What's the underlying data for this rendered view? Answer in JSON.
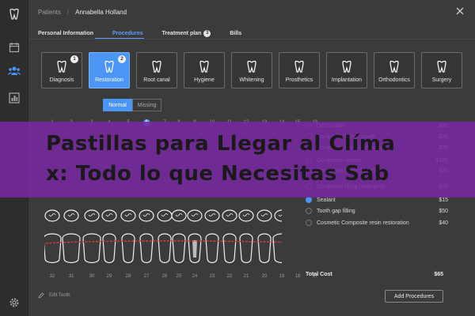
{
  "breadcrumb": {
    "section": "Patients",
    "separator": "/",
    "patient": "Annabella Holland"
  },
  "tabs": [
    {
      "label": "Personal Information",
      "active": false
    },
    {
      "label": "Procedures",
      "active": true
    },
    {
      "label": "Treatment plan",
      "badge": "3",
      "active": false
    },
    {
      "label": "Bills",
      "active": false
    }
  ],
  "procedures": [
    {
      "label": "Diagnosis",
      "icon": "tooth-search-icon",
      "badge": "1",
      "active": false
    },
    {
      "label": "Restoration",
      "icon": "tooth-restoration-icon",
      "badge": "2",
      "active": true
    },
    {
      "label": "Root canal",
      "icon": "tooth-root-icon",
      "badge": "",
      "active": false
    },
    {
      "label": "Hygiene",
      "icon": "tooth-sparkle-icon",
      "badge": "",
      "active": false
    },
    {
      "label": "Whitening",
      "icon": "tooth-whitening-icon",
      "badge": "",
      "active": false
    },
    {
      "label": "Prosthetics",
      "icon": "crown-icon",
      "badge": "",
      "active": false
    },
    {
      "label": "Implantation",
      "icon": "implant-icon",
      "badge": "",
      "active": false
    },
    {
      "label": "Orthodontics",
      "icon": "braces-icon",
      "badge": "",
      "active": false
    },
    {
      "label": "Surgery",
      "icon": "tooth-surgery-icon",
      "badge": "",
      "active": false
    }
  ],
  "view_toggle": {
    "normal": "Normal",
    "missing": "Missing",
    "selected": "Normal"
  },
  "upper_numbers": [
    "1",
    "2",
    "3",
    "4",
    "5",
    "6",
    "7",
    "8",
    "9",
    "10",
    "11",
    "12",
    "13",
    "14",
    "15",
    "16"
  ],
  "upper_selected": "6",
  "lower_numbers": [
    "32",
    "31",
    "30",
    "29",
    "28",
    "27",
    "26",
    "25",
    "24",
    "23",
    "22",
    "21",
    "20",
    "19",
    "18",
    "17"
  ],
  "procedure_list": [
    {
      "name": "Dental dam",
      "price": "$35",
      "checked": false
    },
    {
      "name": "Composite filling (small)",
      "price": "$35",
      "checked": false
    },
    {
      "name": "Composite filling (medium)",
      "price": "$35",
      "checked": false
    },
    {
      "name": "Composite veneer",
      "price": "$100",
      "checked": false
    },
    {
      "name": "Composite filling (large)",
      "price": "$35",
      "checked": false
    },
    {
      "name": "Composite filling (enlarged)",
      "price": "$35",
      "checked": false
    },
    {
      "name": "Sealant",
      "price": "$15",
      "checked": true
    },
    {
      "name": "Tooth gap filling",
      "price": "$50",
      "checked": false
    },
    {
      "name": "Cosmetic Composite resin restoration",
      "price": "$40",
      "checked": false
    }
  ],
  "total": {
    "label": "Total Cost",
    "value": "$65"
  },
  "add_button": "Add Procedures",
  "edit_tooth": "Edit Tooth",
  "overlay_banner": {
    "line1": "Pastillas para Llegar al Clíma",
    "line2": "x: Todo lo que Necesitas Sab"
  },
  "colors": {
    "accent": "#4b95f5",
    "background": "#3b3b3b",
    "sidebar": "#2d2d2d",
    "banner": "#7828a0",
    "treatment_line": "#d23c3c"
  }
}
